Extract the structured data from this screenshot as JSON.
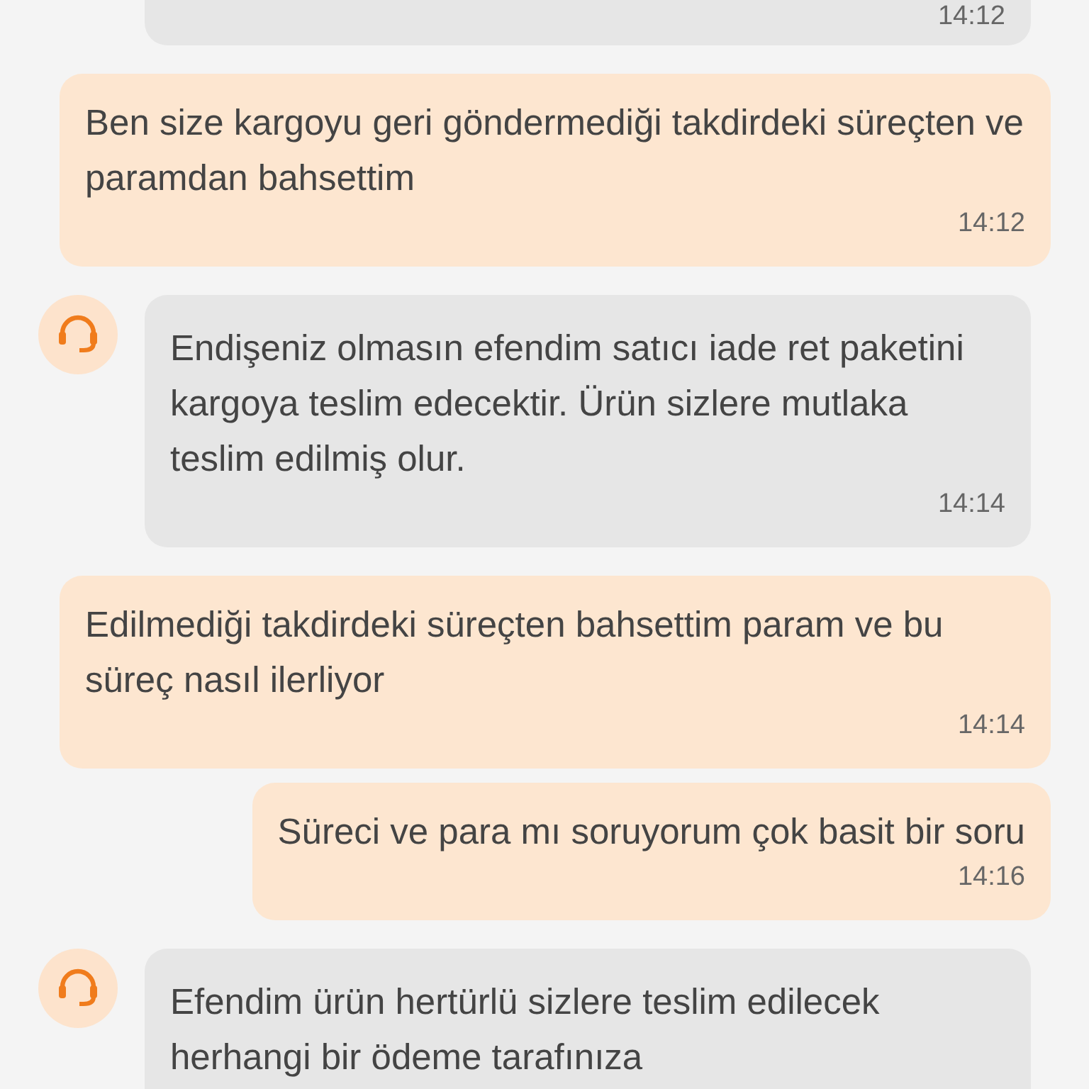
{
  "messages": [
    {
      "kind": "agent",
      "avatar": false,
      "time": "14:12"
    },
    {
      "kind": "user",
      "text": "Ben size kargoyu geri göndermediği takdirdeki süreçten ve paramdan bahsettim",
      "time": "14:12"
    },
    {
      "kind": "agent",
      "avatar": true,
      "text": "Endişeniz olmasın efendim satıcı iade ret paketini kargoya teslim edecektir. Ürün sizlere mutlaka teslim edilmiş olur.",
      "time": "14:14"
    },
    {
      "kind": "user",
      "text": "Edilmediği takdirdeki süreçten bahsettim param ve bu süreç nasıl ilerliyor",
      "time": "14:14"
    },
    {
      "kind": "user",
      "text": "Süreci ve para mı soruyorum çok basit bir soru",
      "time": "14:16"
    },
    {
      "kind": "agent",
      "avatar": true,
      "text": "Efendim ürün hertürlü sizlere teslim edilecek herhangi bir ödeme tarafınıza"
    }
  ]
}
